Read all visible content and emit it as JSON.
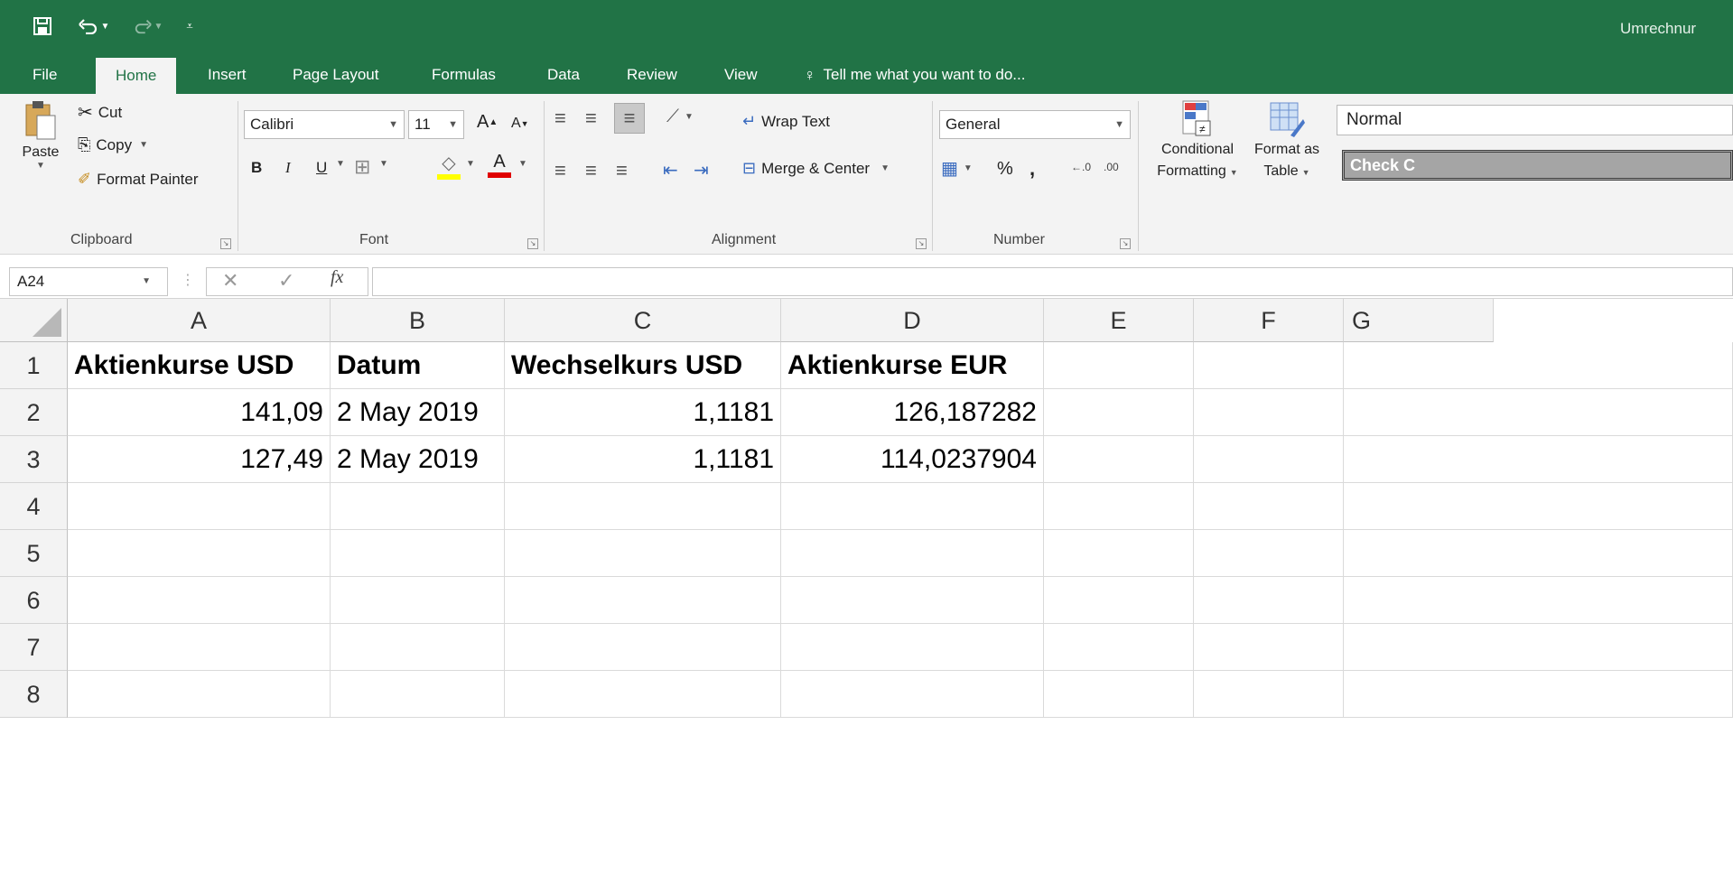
{
  "window": {
    "title": "Umrechnur"
  },
  "quick_access": {
    "save": "save-icon",
    "undo": "undo-icon",
    "redo": "redo-icon",
    "customize": "customize-icon"
  },
  "tabs": [
    {
      "label": "File"
    },
    {
      "label": "Home"
    },
    {
      "label": "Insert"
    },
    {
      "label": "Page Layout"
    },
    {
      "label": "Formulas"
    },
    {
      "label": "Data"
    },
    {
      "label": "Review"
    },
    {
      "label": "View"
    }
  ],
  "tell_me": "Tell me what you want to do...",
  "clipboard": {
    "paste": "Paste",
    "cut": "Cut",
    "copy": "Copy",
    "format_painter": "Format Painter",
    "group": "Clipboard"
  },
  "font": {
    "name": "Calibri",
    "size": "11",
    "bold": "B",
    "italic": "I",
    "underline": "U",
    "group": "Font",
    "fill_color": "#ffff00",
    "font_color": "#ff0000"
  },
  "alignment": {
    "wrap_text": "Wrap Text",
    "merge_center": "Merge & Center",
    "group": "Alignment"
  },
  "number": {
    "format": "General",
    "percent": "%",
    "comma": ",",
    "group": "Number"
  },
  "styles": {
    "conditional": "Conditional",
    "formatting": "Formatting",
    "format_as": "Format as",
    "table": "Table",
    "normal": "Normal",
    "check_cell": "Check C"
  },
  "formula_bar": {
    "name_box": "A24",
    "fx": "fx",
    "value": ""
  },
  "grid": {
    "columns": [
      "A",
      "B",
      "C",
      "D",
      "E",
      "F",
      "G"
    ],
    "rows": [
      "1",
      "2",
      "3",
      "4",
      "5",
      "6",
      "7",
      "8"
    ],
    "cells": {
      "A1": "Aktienkurse USD",
      "B1": "Datum",
      "C1": "Wechselkurs USD",
      "D1": "Aktienkurse EUR",
      "A2": "141,09",
      "B2": "2 May 2019",
      "C2": "1,1181",
      "D2": "126,187282",
      "A3": "127,49",
      "B3": "2 May 2019",
      "C3": "1,1181",
      "D3": "114,0237904"
    }
  },
  "colors": {
    "accent": "#217346"
  }
}
